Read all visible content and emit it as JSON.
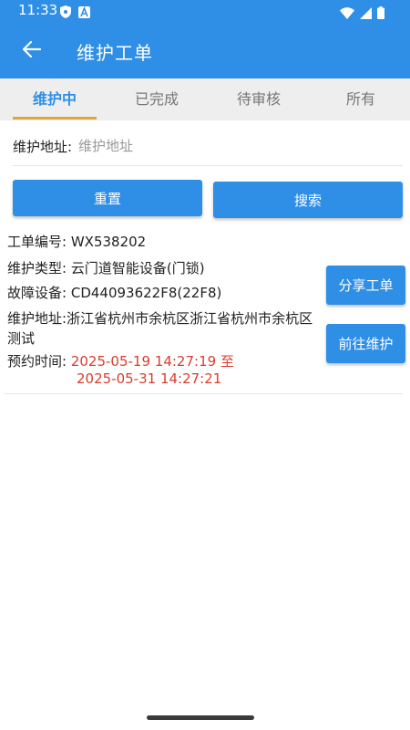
{
  "status_bar": {
    "time": "11:33",
    "icons": [
      "shield-icon",
      "a-icon",
      "wifi-icon",
      "signal-icon",
      "battery-icon"
    ]
  },
  "app_bar": {
    "back_icon": "arrow-left-icon",
    "title": "维护工单"
  },
  "tabs": [
    {
      "label": "维护中",
      "active": true
    },
    {
      "label": "已完成",
      "active": false
    },
    {
      "label": "待审核",
      "active": false
    },
    {
      "label": "所有",
      "active": false
    }
  ],
  "search": {
    "label": "维护地址:",
    "placeholder": "维护地址",
    "value": ""
  },
  "buttons": {
    "reset": "重置",
    "search": "搜索"
  },
  "order": {
    "number_label": "工单编号:",
    "number": "WX538202",
    "type_label": "维护类型:",
    "type": "云门道智能设备(门锁)",
    "device_label": "故障设备:",
    "device": "CD44093622F8(22F8)",
    "address_label": "维护地址:",
    "address": "浙江省杭州市余杭区浙江省杭州市余杭区测试",
    "time_label": "预约时间:",
    "time_start": "2025-05-19 14:27:19 至",
    "time_end": "2025-05-31 14:27:21",
    "share_button": "分享工单",
    "maintain_button": "前往维护"
  },
  "colors": {
    "primary": "#2F8FE6",
    "tab_indicator": "#E8A33C",
    "time_text": "#D93D2E"
  }
}
